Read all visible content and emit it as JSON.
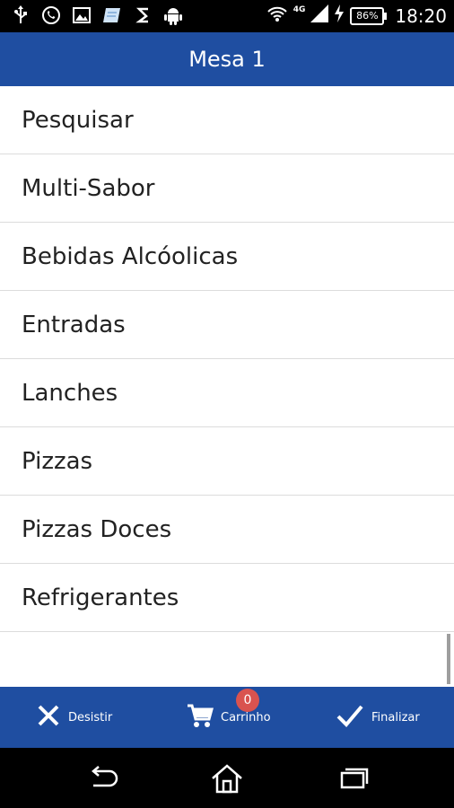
{
  "status_bar": {
    "icons": [
      "usb-icon",
      "whatsapp-icon",
      "image-icon",
      "notebook-icon",
      "s-app-icon",
      "android-icon"
    ],
    "network_label": "4G",
    "battery": "86%",
    "time": "18:20"
  },
  "app_bar": {
    "title": "Mesa 1"
  },
  "menu": {
    "items": [
      {
        "label": "Pesquisar"
      },
      {
        "label": "Multi-Sabor"
      },
      {
        "label": "Bebidas Alcóolicas"
      },
      {
        "label": "Entradas"
      },
      {
        "label": "Lanches"
      },
      {
        "label": "Pizzas"
      },
      {
        "label": "Pizzas Doces"
      },
      {
        "label": "Refrigerantes"
      }
    ]
  },
  "action_bar": {
    "desistir_label": "Desistir",
    "carrinho_label": "Carrinho",
    "carrinho_count": "0",
    "finalizar_label": "Finalizar"
  },
  "nav_bar": {
    "icons": [
      "back-icon",
      "home-icon",
      "recent-apps-icon"
    ]
  },
  "colors": {
    "primary": "#1f4ea1",
    "badge": "#d9534f",
    "text": "#222222",
    "divider": "#dcdcdc"
  }
}
